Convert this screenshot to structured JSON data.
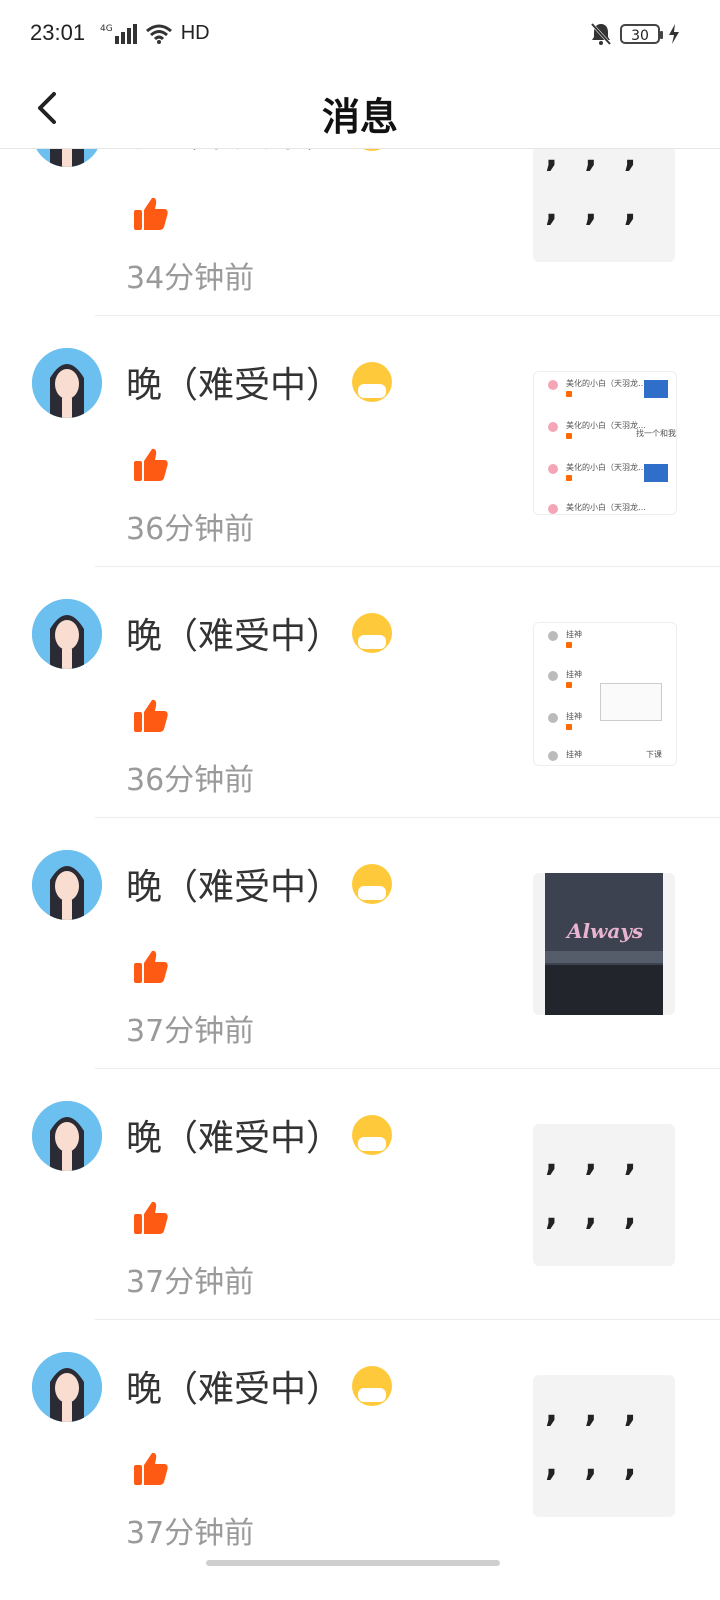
{
  "status_bar": {
    "time": "23:01",
    "network": "4G",
    "hd": "HD",
    "battery": "30"
  },
  "header": {
    "title": "消息"
  },
  "messages": [
    {
      "user": "晚（难受中）",
      "time": "34分钟前",
      "thumb": "commas",
      "commas": [
        ",",
        ",",
        ",",
        ",",
        ",",
        ","
      ]
    },
    {
      "user": "晚（难受中）",
      "time": "36分钟前",
      "thumb": "chat-list",
      "lines": [
        "美化的小白（天羽龙…",
        "美化的小白（天羽龙…",
        "美化的小白（天羽龙…",
        "美化的小白（天羽龙…"
      ],
      "note": "找一个和我一"
    },
    {
      "user": "晚（难受中）",
      "time": "36分钟前",
      "thumb": "chat-list-2",
      "lines": [
        "挂神",
        "挂神",
        "挂神",
        "挂神"
      ],
      "note": "下课"
    },
    {
      "user": "晚（难受中）",
      "time": "37分钟前",
      "thumb": "screenshot",
      "overlay": "Always"
    },
    {
      "user": "晚（难受中）",
      "time": "37分钟前",
      "thumb": "commas",
      "commas": [
        ",",
        ",",
        ",",
        ",",
        ",",
        ","
      ]
    },
    {
      "user": "晚（难受中）",
      "time": "37分钟前",
      "thumb": "commas",
      "commas": [
        ",",
        ",",
        ",",
        ",",
        ",",
        ","
      ]
    }
  ],
  "colors": {
    "like": "#ff5a14",
    "time_text": "#9a9a9a",
    "divider": "#ececec"
  }
}
